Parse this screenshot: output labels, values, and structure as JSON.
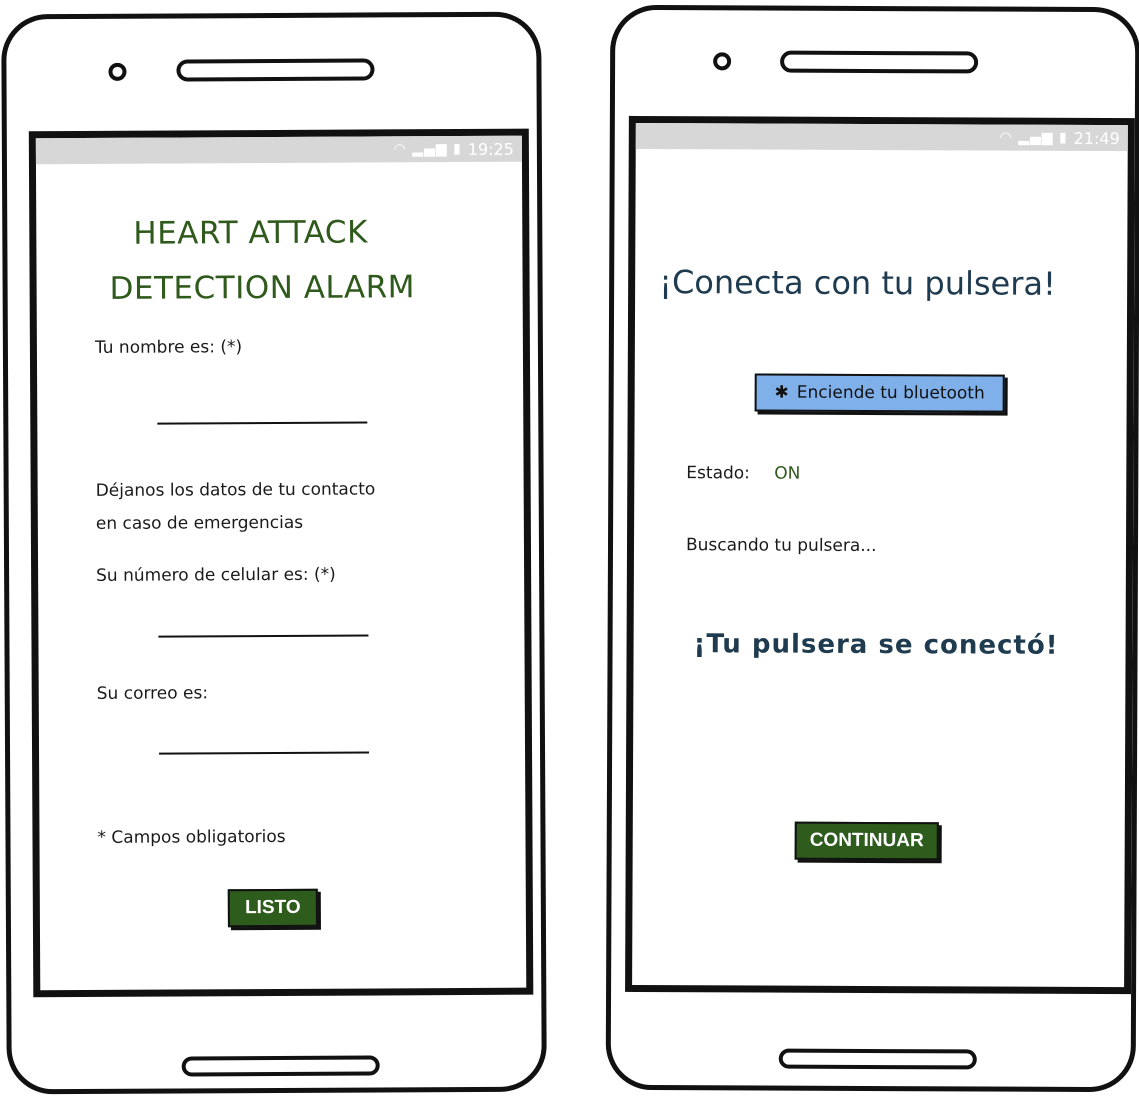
{
  "left_phone": {
    "status_bar": {
      "icons": "wifi-signal-battery",
      "time": "19:25"
    },
    "title_line1": "HEART ATTACK",
    "title_line2": "DETECTION ALARM",
    "name_label": "Tu nombre es: (*)",
    "contact_intro_line1": "Déjanos los datos de tu contacto",
    "contact_intro_line2": "en caso de emergencias",
    "phone_label": "Su número de celular es: (*)",
    "email_label": "Su correo es:",
    "required_note": "* Campos obligatorios",
    "done_button": "LISTO"
  },
  "right_phone": {
    "status_bar": {
      "icons": "wifi-signal-battery",
      "time": "21:49"
    },
    "heading": "¡Conecta con tu pulsera!",
    "bluetooth_button": "Enciende tu bluetooth",
    "status_label": "Estado:",
    "status_value": "ON",
    "searching_text": "Buscando tu pulsera...",
    "connected_text": "¡Tu pulsera se conectó!",
    "continue_button": "CONTINUAR"
  },
  "colors": {
    "accent_green": "#2e5c1d",
    "title_green": "#2f5a1c",
    "bluetooth_blue": "#7fb0ea",
    "status_gray": "#d7d7d7"
  }
}
